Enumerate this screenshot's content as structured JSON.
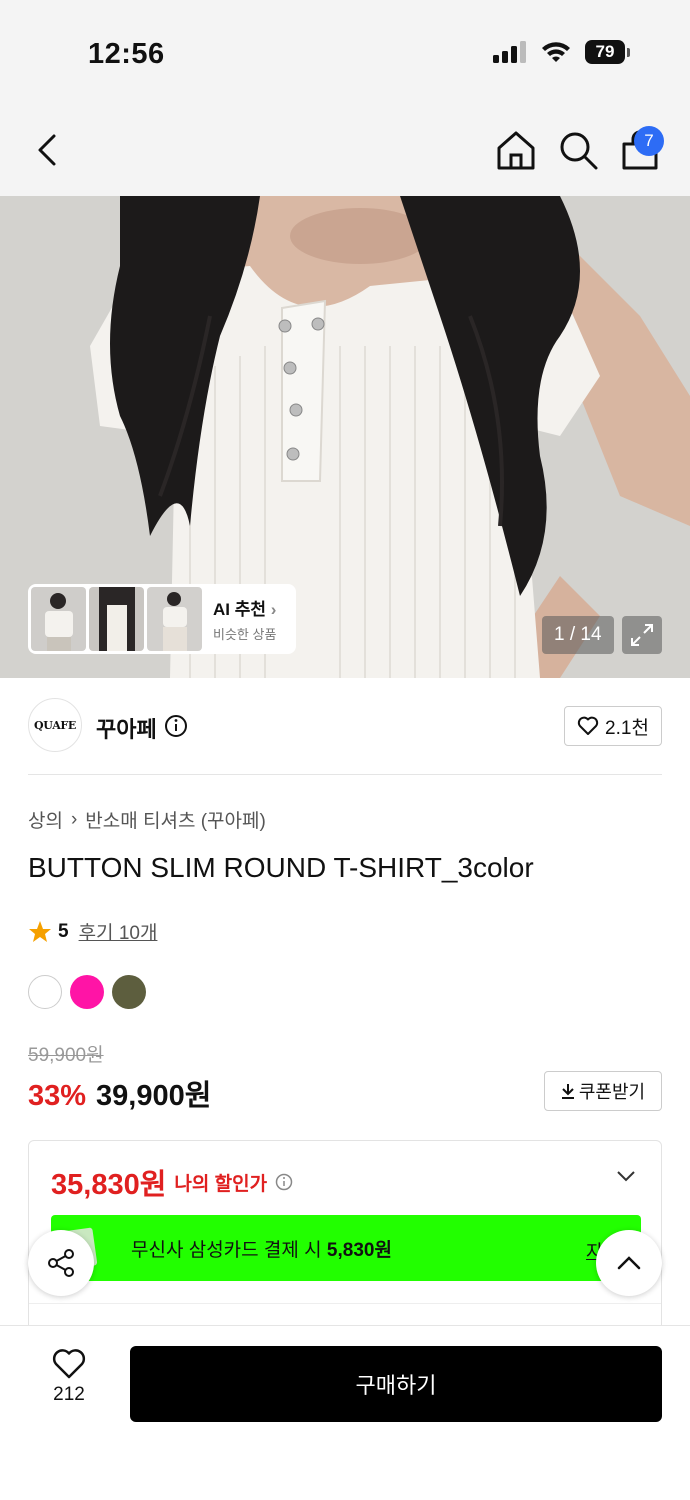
{
  "status_bar": {
    "time": "12:56",
    "battery": "79"
  },
  "nav": {
    "cart_count": "7"
  },
  "hero": {
    "ai_title": "AI 추천",
    "ai_subtitle": "비슷한 상품",
    "page_indicator": "1 / 14"
  },
  "brand": {
    "logo_text": "QUAFE",
    "name": "꾸아페",
    "likes": "2.1천"
  },
  "product": {
    "breadcrumb": [
      "상의",
      "반소매 티셔츠 (꾸아페)"
    ],
    "title": "BUTTON SLIM ROUND T-SHIRT_3color",
    "rating_score": "5",
    "review_link": "후기 10개",
    "colors": [
      "#ffffff",
      "#ff14a6",
      "#5d5e3e"
    ],
    "original_price": "59,900원",
    "discount_rate": "33%",
    "sale_price": "39,900원",
    "coupon_label": "쿠폰받기"
  },
  "benefit": {
    "my_price": "35,830원",
    "my_price_label": "나의 할인가",
    "card_text_prefix": "무신사 삼성카드 결제 시 ",
    "card_text_amount": "5,830원",
    "card_detail": "자세"
  },
  "bottom": {
    "like_count": "212",
    "buy_label": "구매하기"
  }
}
